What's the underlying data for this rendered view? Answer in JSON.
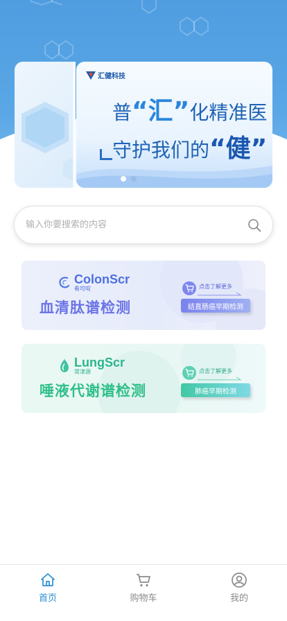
{
  "banner": {
    "brand": "汇健科技",
    "slogan_line1_a": "普",
    "slogan_line1_b": "“汇”",
    "slogan_line1_c": "化精准医",
    "slogan_line2_a": "守护我们的",
    "slogan_line2_b": "“健”",
    "slide_count": 2,
    "active_slide": 1
  },
  "search": {
    "placeholder": "输入你要搜索的内容",
    "value": ""
  },
  "products": [
    {
      "brand_en": "ColonScr",
      "brand_cn": "肴可啶",
      "title": "血清肽谱检测",
      "more": "点击了解更多",
      "button": "结直肠癌早期检测",
      "accent": "#6b74e6"
    },
    {
      "brand_en": "LungScr",
      "brand_cn": "常津源",
      "title": "唾液代谢谱检测",
      "more": "点击了解更多",
      "button": "肺癌早期检测",
      "accent": "#2fbf8a"
    }
  ],
  "tabbar": {
    "items": [
      {
        "label": "首页",
        "icon": "home-icon",
        "active": true
      },
      {
        "label": "购物车",
        "icon": "cart-icon",
        "active": false
      },
      {
        "label": "我的",
        "icon": "user-icon",
        "active": false
      }
    ],
    "active_color": "#2a8fd6",
    "inactive_color": "#8a8a8a"
  }
}
